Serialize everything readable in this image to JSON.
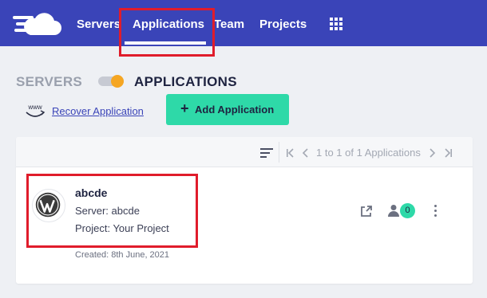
{
  "nav": {
    "items": [
      {
        "label": "Servers"
      },
      {
        "label": "Applications"
      },
      {
        "label": "Team"
      },
      {
        "label": "Projects"
      }
    ],
    "active": "Applications"
  },
  "header": {
    "servers_label": "SERVERS",
    "applications_label": "APPLICATIONS"
  },
  "actions": {
    "recover_icon_text": "www",
    "recover_label": "Recover Application",
    "add_label": "Add Application"
  },
  "toolbar": {
    "pagination_text": "1 to 1 of 1 Applications"
  },
  "application": {
    "name": "abcde",
    "server": "Server: abcde",
    "project": "Project: Your Project",
    "created": "Created: 8th June, 2021",
    "user_count": "0"
  },
  "colors": {
    "nav_bg": "#3a44b8",
    "accent_green": "#2ed9a8",
    "toggle_knob": "#f5a623",
    "highlight_red": "#e01c2b"
  },
  "icons": [
    "cloud-logo-icon",
    "apps-grid-icon",
    "www-icon",
    "plus-icon",
    "sort-icon",
    "first-page-icon",
    "prev-page-icon",
    "next-page-icon",
    "last-page-icon",
    "wordpress-icon",
    "external-link-icon",
    "user-icon",
    "kebab-menu-icon"
  ]
}
